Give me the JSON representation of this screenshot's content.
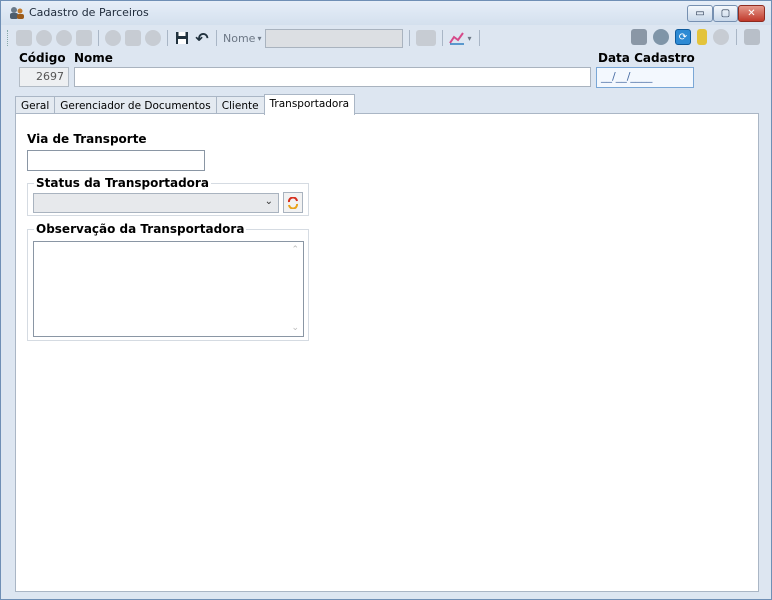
{
  "window": {
    "title": "Cadastro de Parceiros",
    "min_glyph": "▭",
    "max_glyph": "▢",
    "close_glyph": "✕"
  },
  "toolbar": {
    "nome_label": "Nome",
    "nome_caret": "▾",
    "nome_value": "",
    "save_glyph": "💾",
    "undo_glyph": "↶",
    "refresh_glyph": "⟳"
  },
  "header": {
    "codigo_label": "Código",
    "codigo_value": "2697",
    "nome_label": "Nome",
    "nome_value": "",
    "data_label": "Data Cadastro",
    "data_value": "__/__/____"
  },
  "tabs": [
    {
      "label": "Geral"
    },
    {
      "label": "Gerenciador de Documentos"
    },
    {
      "label": "Cliente"
    },
    {
      "label": "Transportadora",
      "active": true
    }
  ],
  "transportadora": {
    "via_label": "Via de Transporte",
    "via_value": "",
    "status_label": "Status da Transportadora",
    "status_value": "",
    "status_caret": "⌄",
    "obs_label": "Observação da Transportadora",
    "obs_value": "",
    "scroll_up": "⌃",
    "scroll_down": "⌄"
  }
}
